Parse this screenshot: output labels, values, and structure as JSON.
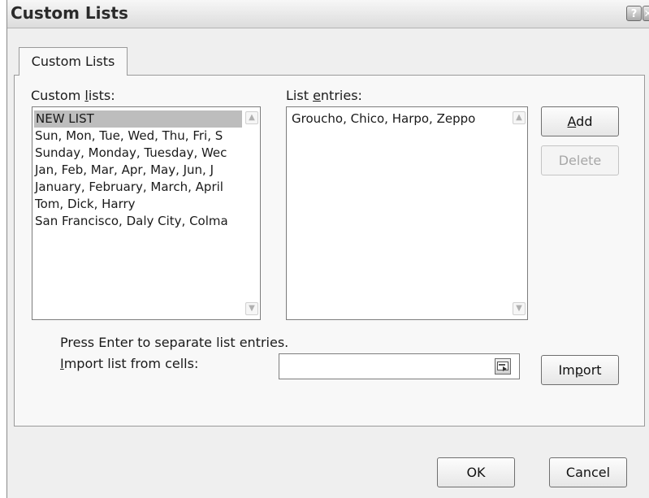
{
  "window": {
    "title": "Custom Lists",
    "help_glyph": "?",
    "close_glyph": "✕"
  },
  "tab": {
    "label": "Custom Lists"
  },
  "custom_lists": {
    "label_pre": "Custom ",
    "label_key": "l",
    "label_post": "ists:",
    "items": [
      "NEW LIST",
      "Sun, Mon, Tue, Wed, Thu, Fri, S",
      "Sunday, Monday, Tuesday, Wec",
      "Jan, Feb, Mar, Apr, May, Jun, J",
      "January, February, March, April",
      "Tom, Dick, Harry",
      "San Francisco, Daly City, Colma"
    ],
    "selected_index": 0
  },
  "list_entries": {
    "label_pre": "List ",
    "label_key": "e",
    "label_post": "ntries:",
    "value": "Groucho, Chico, Harpo, Zeppo"
  },
  "buttons": {
    "add_key": "A",
    "add_rest": "dd",
    "delete": "Delete",
    "import_pre": "Im",
    "import_key": "p",
    "import_post": "ort",
    "ok": "OK",
    "cancel": "Cancel"
  },
  "hint": "Press Enter to separate list entries.",
  "import_field": {
    "label_key": "I",
    "label_rest": "mport list from cells:",
    "value": ""
  },
  "scroll_up_glyph": "▲",
  "scroll_down_glyph": "▼"
}
